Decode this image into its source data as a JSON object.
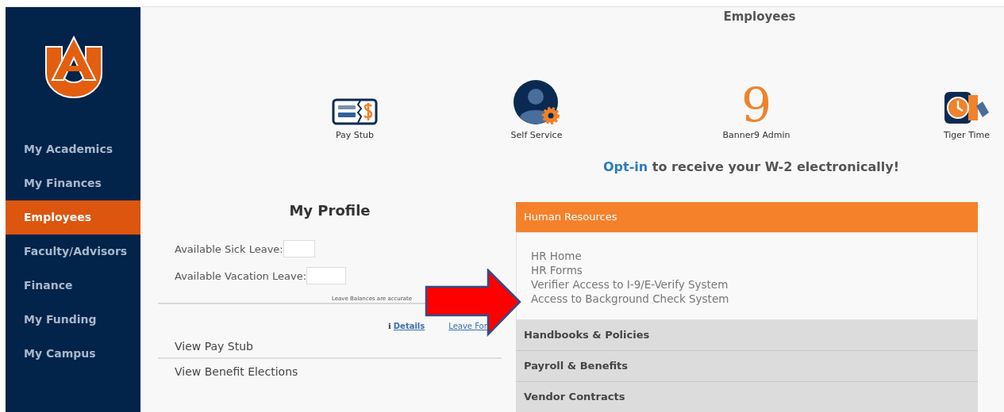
{
  "sidebar": {
    "items": [
      {
        "label": "My Academics",
        "selected": false
      },
      {
        "label": "My Finances",
        "selected": false
      },
      {
        "label": "Employees",
        "selected": true
      },
      {
        "label": "Faculty/Advisors",
        "selected": false
      },
      {
        "label": "Finance",
        "selected": false
      },
      {
        "label": "My Funding",
        "selected": false
      },
      {
        "label": "My Campus",
        "selected": false
      }
    ]
  },
  "page_title": "Employees",
  "tiles": [
    {
      "kind": "paystub",
      "label": "Pay Stub"
    },
    {
      "kind": "person",
      "label": "Self Service"
    },
    {
      "kind": "glyph",
      "glyph": "9",
      "label": "Banner9 Admin"
    },
    {
      "kind": "clock",
      "label": "Tiger Time"
    }
  ],
  "optin": {
    "link": "Opt-in",
    "text": "to receive your W-2 electronically!"
  },
  "profile": {
    "title": "My Profile",
    "fields": [
      {
        "label": "Available Sick Leave:"
      },
      {
        "label": "Available Vacation Leave:"
      }
    ],
    "note": "Leave Balances are accurate",
    "links": [
      {
        "kind": "info",
        "icon": "ℹ",
        "label": "Details"
      },
      {
        "kind": "plain",
        "label": "Leave For"
      }
    ],
    "actions": [
      "View Pay Stub",
      "View Benefit Elections"
    ]
  },
  "sections": [
    {
      "title": "Human Resources",
      "expanded": true,
      "links": [
        "HR Home",
        "HR Forms",
        "Verifier Access to I-9/E-Verify System",
        "Access to Background Check System"
      ]
    },
    {
      "title": "Handbooks & Policies",
      "expanded": false
    },
    {
      "title": "Payroll & Benefits",
      "expanded": false
    },
    {
      "title": "Vendor Contracts",
      "expanded": false
    }
  ]
}
